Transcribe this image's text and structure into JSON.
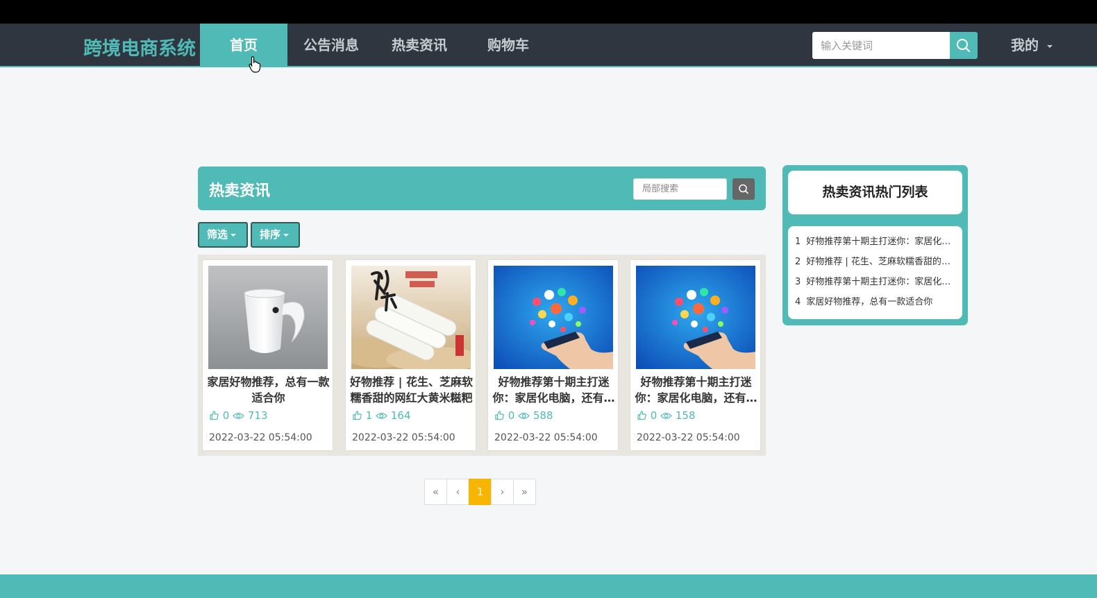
{
  "nav": {
    "brand": "跨境电商系统",
    "items": [
      {
        "label": "首页",
        "active": true
      },
      {
        "label": "公告消息",
        "active": false
      },
      {
        "label": "热卖资讯",
        "active": false
      },
      {
        "label": "购物车",
        "active": false
      }
    ],
    "search_placeholder": "输入关键词",
    "mine_label": "我的"
  },
  "panel": {
    "title": "热卖资讯",
    "local_search_placeholder": "局部搜索",
    "filter_label": "筛选",
    "sort_label": "排序"
  },
  "cards": [
    {
      "title": "家居好物推荐，总有一款适合你",
      "likes": "0",
      "views": "713",
      "date": "2022-03-22 05:54:00",
      "image": "white-cup"
    },
    {
      "title": "好物推荐 | 花生、芝麻软糯香甜的网红大黄米糍粑",
      "likes": "1",
      "views": "164",
      "date": "2022-03-22 05:54:00",
      "image": "rice-cake"
    },
    {
      "title": "好物推荐第十期主打迷你：家居化电脑，还有更多",
      "likes": "0",
      "views": "588",
      "date": "2022-03-22 05:54:00",
      "image": "phone-apps"
    },
    {
      "title": "好物推荐第十期主打迷你：家居化电脑，还有更多",
      "likes": "0",
      "views": "158",
      "date": "2022-03-22 05:54:00",
      "image": "phone-apps"
    }
  ],
  "pagination": {
    "first": "«",
    "prev": "‹",
    "current": "1",
    "next": "›",
    "last": "»"
  },
  "sidebar": {
    "title": "热卖资讯热门列表",
    "items": [
      {
        "num": "1",
        "text": "好物推荐第十期主打迷你：家居化电脑，还有更多"
      },
      {
        "num": "2",
        "text": "好物推荐 | 花生、芝麻软糯香甜的网红大黄米糍粑"
      },
      {
        "num": "3",
        "text": "好物推荐第十期主打迷你：家居化电脑，还有更多"
      },
      {
        "num": "4",
        "text": "家居好物推荐，总有一款适合你"
      }
    ]
  },
  "colors": {
    "accent": "#4fbab6",
    "nav_bg": "#2f3640",
    "page_current": "#f7b500"
  }
}
